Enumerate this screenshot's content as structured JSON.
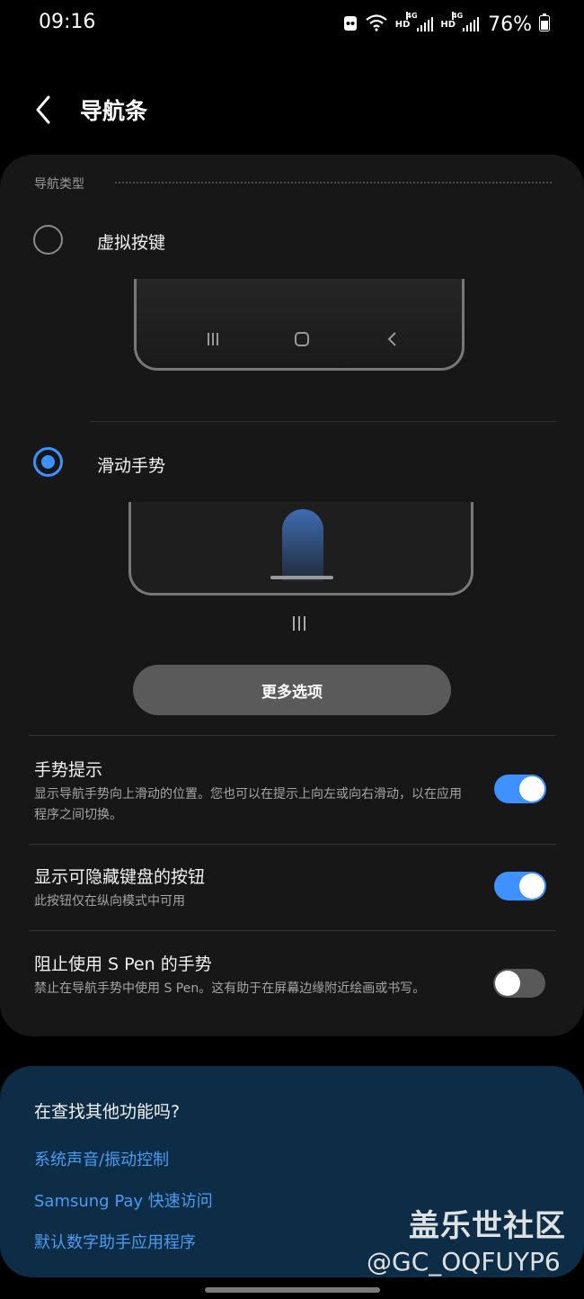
{
  "status_bar": {
    "time": "09:16",
    "hd_1": "HD",
    "net_1": "4G",
    "hd_2": "HD",
    "net_2": "4G",
    "battery": "76%"
  },
  "header": {
    "back_icon": "chevron-left-icon",
    "title": "导航条"
  },
  "nav_type": {
    "section_label": "导航类型",
    "options": [
      {
        "label": "虚拟按键",
        "selected": false
      },
      {
        "label": "滑动手势",
        "selected": true
      }
    ],
    "buttons_preview_icons": [
      "recents-icon",
      "home-icon",
      "back-icon"
    ],
    "more_options_label": "更多选项"
  },
  "settings": [
    {
      "title": "手势提示",
      "desc": "显示导航手势向上滑动的位置。您也可以在提示上向左或向右滑动，以在应用程序之间切换。",
      "enabled": true
    },
    {
      "title": "显示可隐藏键盘的按钮",
      "desc": "此按钮仅在纵向模式中可用",
      "enabled": true
    },
    {
      "title": "阻止使用 S Pen 的手势",
      "desc": "禁止在导航手势中使用 S Pen。这有助于在屏幕边缘附近绘画或书写。",
      "enabled": false
    }
  ],
  "looking_for": {
    "title": "在查找其他功能吗?",
    "links": [
      "系统声音/振动控制",
      "Samsung Pay 快速访问",
      "默认数字助手应用程序"
    ]
  },
  "watermark": {
    "brand": "盖乐世社区",
    "user": "@GC_OQFUYP6"
  },
  "colors": {
    "accent": "#3e91ff",
    "card_bg": "#171717",
    "panel_bg": "#0d2d47",
    "link": "#4a9bf0"
  }
}
